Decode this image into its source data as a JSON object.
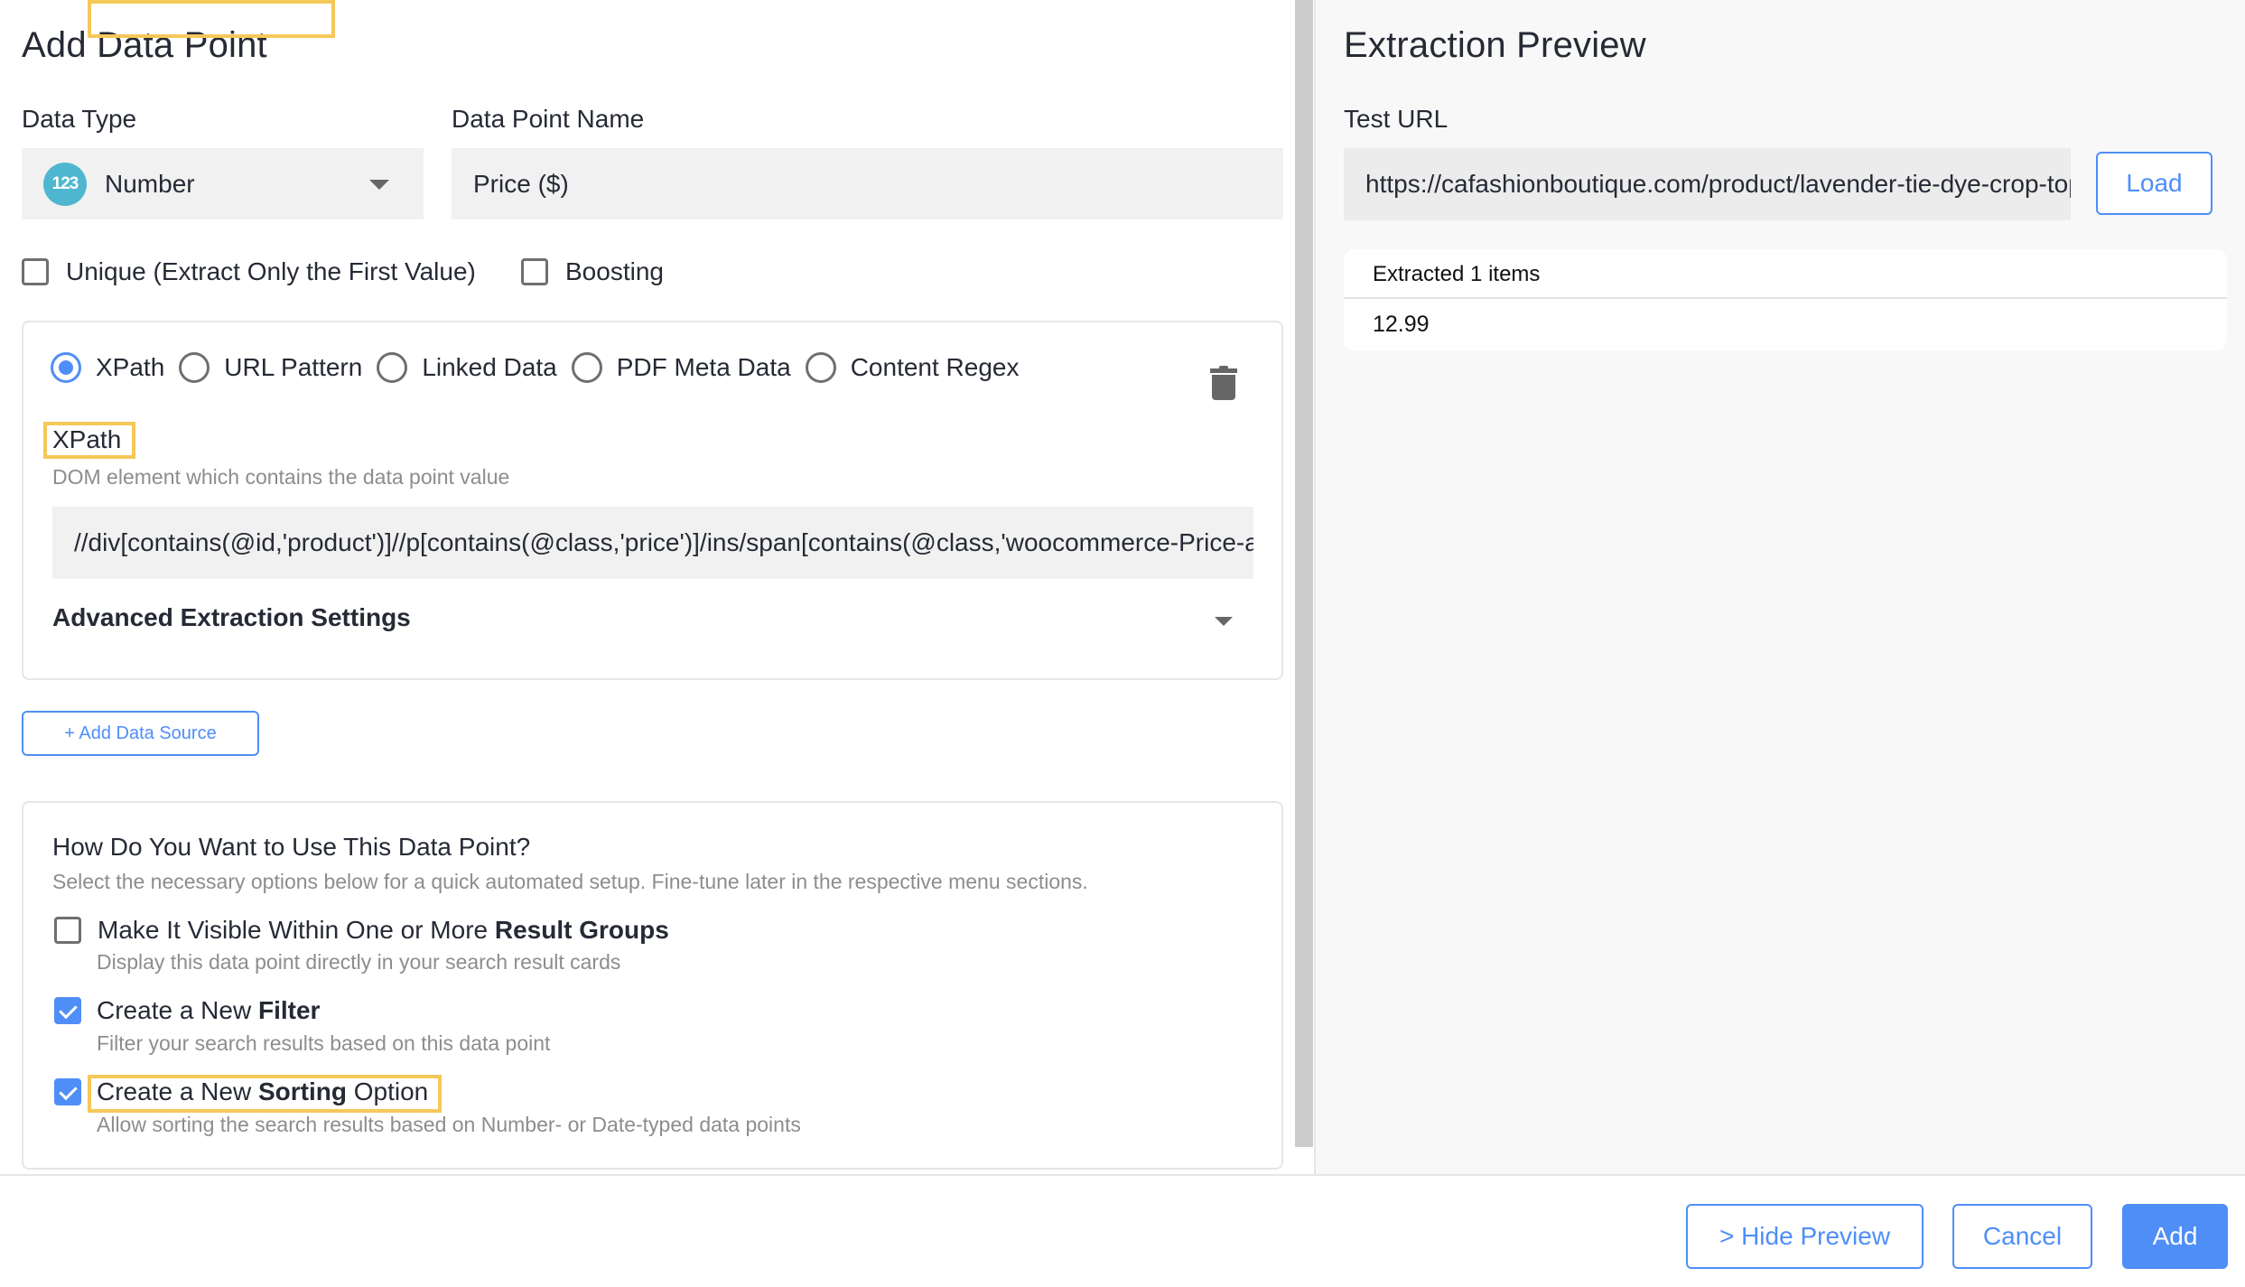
{
  "left_panel": {
    "title": "Add Data Point",
    "data_type": {
      "label": "Data Type",
      "icon": "number-123-icon",
      "icon_text": "123",
      "value": "Number"
    },
    "data_point_name": {
      "label": "Data Point Name",
      "value": "Price ($)"
    },
    "options": [
      {
        "label": "Unique (Extract Only the First Value)",
        "checked": false
      },
      {
        "label": "Boosting",
        "checked": false
      }
    ],
    "source_card": {
      "source_types": [
        {
          "label": "XPath",
          "selected": true
        },
        {
          "label": "URL Pattern",
          "selected": false
        },
        {
          "label": "Linked Data",
          "selected": false
        },
        {
          "label": "PDF Meta Data",
          "selected": false
        },
        {
          "label": "Content Regex",
          "selected": false
        }
      ],
      "delete_icon": "trash-icon",
      "field_label": "XPath",
      "field_help": "DOM element which contains the data point value",
      "field_value": "//div[contains(@id,'product')]//p[contains(@class,'price')]/ins/span[contains(@class,'woocommerce-Price-amount')]",
      "advanced_label": "Advanced Extraction Settings"
    },
    "add_source_button": "+ Add Data Source",
    "usage_card": {
      "title": "How Do You Want to Use This Data Point?",
      "subtitle": "Select the necessary options below for a quick automated setup. Fine-tune later in the respective menu sections.",
      "items": [
        {
          "label_prefix": "Make It Visible Within One or More ",
          "label_bold": "Result Groups",
          "label_suffix": "",
          "description": "Display this data point directly in your search result cards",
          "checked": false
        },
        {
          "label_prefix": "Create a New ",
          "label_bold": "Filter",
          "label_suffix": "",
          "description": "Filter your search results based on this data point",
          "checked": true
        },
        {
          "label_prefix": "Create a New ",
          "label_bold": "Sorting",
          "label_suffix": " Option",
          "description": "Allow sorting the search results based on Number- or Date-typed data points",
          "checked": true
        }
      ]
    }
  },
  "right_panel": {
    "title": "Extraction Preview",
    "test_url_label": "Test URL",
    "test_url_value": "https://cafashionboutique.com/product/lavender-tie-dye-crop-top/",
    "load_button": "Load",
    "results": {
      "header": "Extracted 1 items",
      "values": [
        "12.99"
      ]
    }
  },
  "footer": {
    "hide_preview": "> Hide Preview",
    "cancel": "Cancel",
    "add": "Add"
  },
  "colors": {
    "accent": "#4f8ef7",
    "highlight": "#f5c85a",
    "type_icon": "#4fb6d0",
    "text": "#262a35",
    "muted": "#8d8d8d"
  }
}
